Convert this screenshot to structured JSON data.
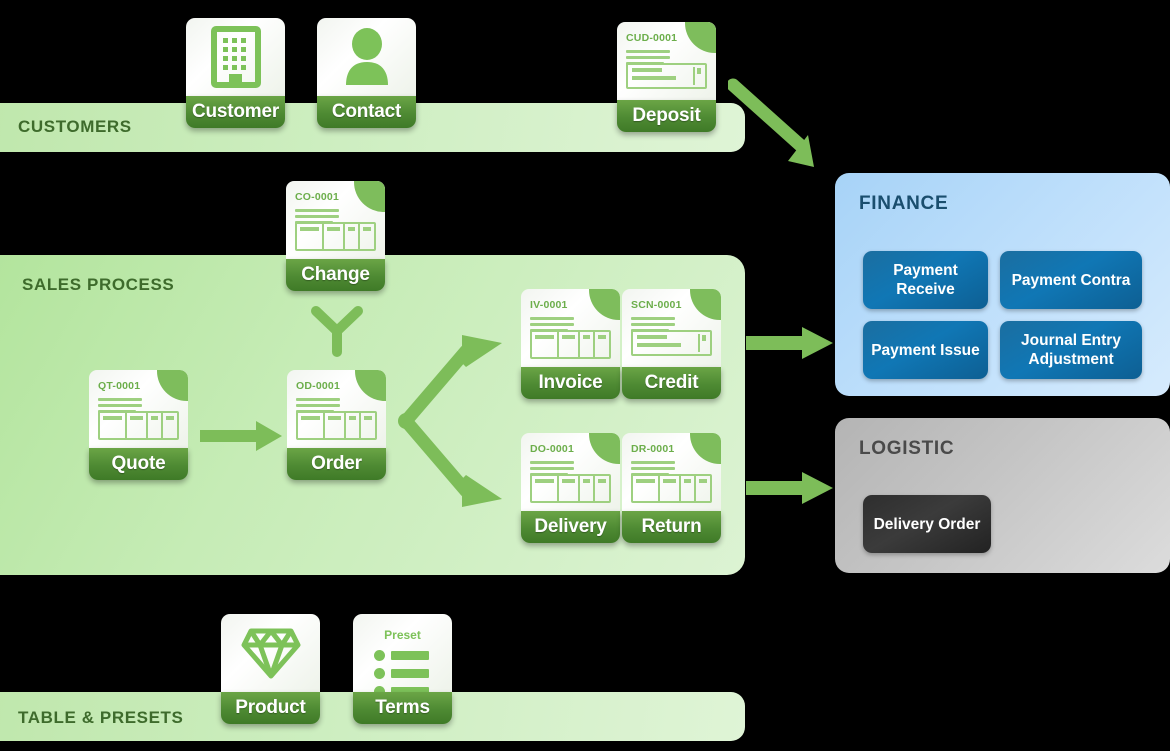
{
  "sections": {
    "customers": {
      "title": "CUSTOMERS"
    },
    "sales": {
      "title": "SALES PROCESS"
    },
    "tables": {
      "title": "TABLE & PRESETS"
    },
    "finance": {
      "title": "FINANCE"
    },
    "logistic": {
      "title": "LOGISTIC"
    }
  },
  "cards": {
    "customer": {
      "label": "Customer",
      "icon": "building-icon"
    },
    "contact": {
      "label": "Contact",
      "icon": "person-icon"
    },
    "deposit": {
      "label": "Deposit",
      "code": "CUD-0001",
      "icon": "cheque-icon"
    },
    "change": {
      "label": "Change",
      "code": "CO-0001",
      "icon": "document-table-icon"
    },
    "quote": {
      "label": "Quote",
      "code": "QT-0001",
      "icon": "document-table-icon"
    },
    "order": {
      "label": "Order",
      "code": "OD-0001",
      "icon": "document-table-icon"
    },
    "invoice": {
      "label": "Invoice",
      "code": "IV-0001",
      "icon": "document-table-icon"
    },
    "credit": {
      "label": "Credit",
      "code": "SCN-0001",
      "icon": "cheque-icon"
    },
    "delivery": {
      "label": "Delivery",
      "code": "DO-0001",
      "icon": "document-table-icon"
    },
    "return": {
      "label": "Return",
      "code": "DR-0001",
      "icon": "document-table-icon"
    },
    "product": {
      "label": "Product",
      "icon": "diamond-icon"
    },
    "terms": {
      "label": "Terms",
      "icon": "preset-list-icon",
      "preset_word": "Preset"
    }
  },
  "finance_buttons": [
    {
      "label": "Payment Receive"
    },
    {
      "label": "Payment Contra"
    },
    {
      "label": "Payment Issue"
    },
    {
      "label": "Journal Entry Adjustment"
    }
  ],
  "logistic_buttons": [
    {
      "label": "Delivery Order"
    }
  ],
  "colors": {
    "background": "#000000",
    "band_green": "#cdeec0",
    "panel_green": "#c6ecb6",
    "label_green_dark": "#3f7a27",
    "label_green_light": "#6ba546",
    "icon_green": "#7dc259",
    "fold_green": "#7ebd5c",
    "title_green": "#3e6b2c",
    "arrow_green": "#7dbd59",
    "finance_panel": "#bcdefb",
    "finance_button": "#1077b5",
    "finance_title": "#1a4e6e",
    "logistic_panel": "#c5c5c5",
    "logistic_button": "#3b3b3b",
    "logistic_title": "#4a4a4a"
  }
}
